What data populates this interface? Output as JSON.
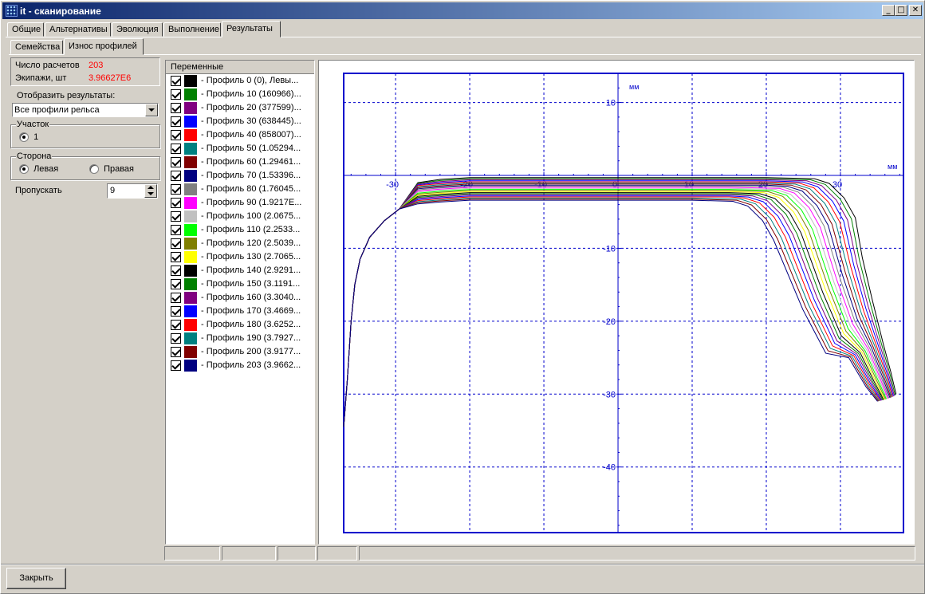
{
  "window": {
    "title": "it - сканирование",
    "min": "_",
    "max": "□",
    "close": "✕"
  },
  "main_tabs": [
    "Общие",
    "Альтернативы",
    "Эволюция",
    "Выполнение",
    "Результаты"
  ],
  "sub_tabs": [
    "Семейства",
    "Износ профилей"
  ],
  "info": {
    "runs_label": "Число расчетов",
    "runs_value": "203",
    "crews_label": "Экипажи, шт",
    "crews_value": "3.96627E6"
  },
  "display": {
    "label": "Отобразить результаты:",
    "value": "Все профили рельса"
  },
  "section": {
    "label": "Участок",
    "option": "1"
  },
  "side": {
    "label": "Сторона",
    "left": "Левая",
    "right": "Правая"
  },
  "skip": {
    "label": "Пропускать",
    "value": "9"
  },
  "legend": {
    "header": "Переменные",
    "items": [
      {
        "label": "- Профиль 0 (0), Левы...",
        "color": "#000000"
      },
      {
        "label": "- Профиль 10 (160966)...",
        "color": "#008000"
      },
      {
        "label": "- Профиль 20 (377599)...",
        "color": "#800080"
      },
      {
        "label": "- Профиль 30 (638445)...",
        "color": "#0000ff"
      },
      {
        "label": "- Профиль 40 (858007)...",
        "color": "#ff0000"
      },
      {
        "label": "- Профиль 50 (1.05294...",
        "color": "#008080"
      },
      {
        "label": "- Профиль 60 (1.29461...",
        "color": "#800000"
      },
      {
        "label": "- Профиль 70 (1.53396...",
        "color": "#000080"
      },
      {
        "label": "- Профиль 80 (1.76045...",
        "color": "#808080"
      },
      {
        "label": "- Профиль 90 (1.9217E...",
        "color": "#ff00ff"
      },
      {
        "label": "- Профиль 100 (2.0675...",
        "color": "#c0c0c0"
      },
      {
        "label": "- Профиль 110 (2.2533...",
        "color": "#00ff00"
      },
      {
        "label": "- Профиль 120 (2.5039...",
        "color": "#808000"
      },
      {
        "label": "- Профиль 130 (2.7065...",
        "color": "#ffff00"
      },
      {
        "label": "- Профиль 140 (2.9291...",
        "color": "#000000"
      },
      {
        "label": "- Профиль 150 (3.1191...",
        "color": "#008000"
      },
      {
        "label": "- Профиль 160 (3.3040...",
        "color": "#800080"
      },
      {
        "label": "- Профиль 170 (3.4669...",
        "color": "#0000ff"
      },
      {
        "label": "- Профиль 180 (3.6252...",
        "color": "#ff0000"
      },
      {
        "label": "- Профиль 190 (3.7927...",
        "color": "#008080"
      },
      {
        "label": "- Профиль 200 (3.9177...",
        "color": "#800000"
      },
      {
        "label": "- Профиль 203 (3.9662...",
        "color": "#000080"
      }
    ]
  },
  "close_button": "Закрыть",
  "chart_data": {
    "type": "line",
    "xlabel": "мм",
    "ylabel": "мм",
    "xlim": [
      -37,
      38.5
    ],
    "ylim": [
      -49,
      14
    ],
    "x_ticks": [
      -30,
      -20,
      -10,
      0,
      10,
      20,
      30
    ],
    "y_ticks": [
      10,
      -10,
      -20,
      -30,
      -40
    ],
    "grid": true,
    "axis_color": "#0000cc",
    "series_count": 22,
    "series_colors": [
      "#000000",
      "#008000",
      "#800080",
      "#0000ff",
      "#ff0000",
      "#008080",
      "#800000",
      "#000080",
      "#808080",
      "#ff00ff",
      "#c0c0c0",
      "#00ff00",
      "#808000",
      "#ffff00",
      "#000000",
      "#008000",
      "#800080",
      "#0000ff",
      "#ff0000",
      "#008080",
      "#800000",
      "#000080"
    ],
    "profile_top_y_first": -0.3,
    "profile_top_y_last": -3.4,
    "profile_knee_x_first": 30.5,
    "profile_knee_x_last": 19.5,
    "profile_end_y_first": -30,
    "profile_end_y_last": -31
  }
}
